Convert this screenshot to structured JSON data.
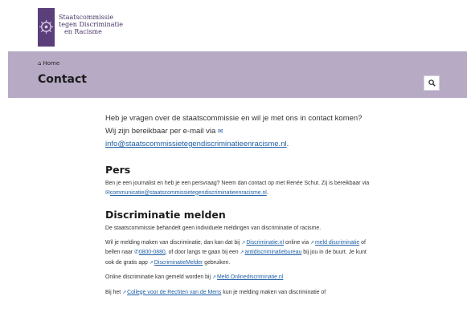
{
  "logo": {
    "line1": "Staatscommissie",
    "line2": "tegen Discriminatie",
    "line3": "en Racisme"
  },
  "breadcrumb": {
    "home": "Home"
  },
  "page": {
    "title": "Contact"
  },
  "intro": {
    "text": "Heb je vragen over de staatscommissie en wil je met ons in contact komen? Wij zijn bereikbaar per e-mail via",
    "email": "info@staatscommissietegendiscriminatieenracisme.nl",
    "end": "."
  },
  "pers": {
    "heading": "Pers",
    "text1": "Ben je een journalist en heb je een persvraag? Neem dan contact op met Renée Schut. Zij is bereikbaar via",
    "email": "communicatie@staatscommissietegendiscriminatieenracisme.nl",
    "end": "."
  },
  "melden": {
    "heading": "Discriminatie melden",
    "p1": "De staatscommissie behandelt geen individuele meldingen van discriminatie of racisme.",
    "p2a": "Wil je melding maken van discriminatie, dan kan dat bij",
    "link1": "Discriminatie.nl",
    "p2b": "online via",
    "link2": "meld discriminatie",
    "p2c": "of bellen naar",
    "phone": "0800-0880",
    "p2d": ", of door langs te gaan bij een",
    "link3": "antidiscriminatiebureau",
    "p2e": "bij jou in de buurt. Je kunt ook de gratis app",
    "link4": "DiscriminatieMelder",
    "p2f": "gebruiken.",
    "p3a": "Online discriminatie kan gemeld worden bij",
    "link5": "Meld.Onlinediscriminatie.nl",
    "p4a": "Bij het",
    "link6": "College voor de Rechten van de Mens",
    "p4b": "kun je melding maken van discriminatie of"
  },
  "icons": {
    "home": "home-icon",
    "search": "search-icon",
    "mail": "mail-icon",
    "phone": "phone-icon",
    "external": "external-link-icon"
  },
  "colors": {
    "brand": "#5b3f7a",
    "band": "#b7aac4",
    "link": "#1f5fa6"
  }
}
